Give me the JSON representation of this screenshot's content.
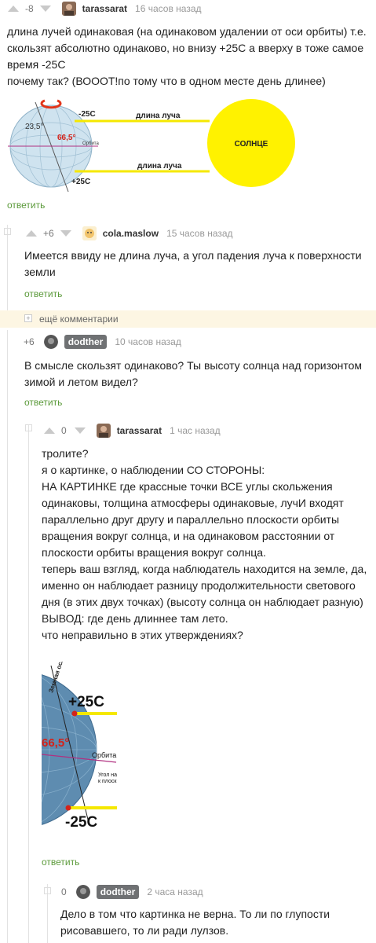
{
  "comments": [
    {
      "rating": "-8",
      "user": "tarassarat",
      "time": "16 часов назад",
      "text": [
        "длина лучей одинаковая (на одинаковом удалении от оси орбиты) т.е.",
        "скользят абсолютно одинаково, но внизу +25С а вверху в тоже самое",
        "время -25С",
        "почему так? (ВОООТ!по тому что в одном месте день длинее)"
      ],
      "reply": "ответить",
      "diagram1": {
        "top_temp": "-25С",
        "bottom_temp": "+25С",
        "ray_label_top": "длина луча",
        "ray_label_bottom": "длина луча",
        "sun_label": "СОЛНЦЕ",
        "angle_small": "23,5°",
        "angle_big": "66,5°",
        "orbit_label": "Орбита"
      }
    },
    {
      "rating": "+6",
      "user": "cola.maslow",
      "time": "15 часов назад",
      "text": [
        "Имеется ввиду не длина луча, а угол падения луча к поверхности",
        "земли"
      ],
      "reply": "ответить"
    },
    {
      "more": "ещё комментарии"
    },
    {
      "rating": "+6",
      "user": "dodther",
      "time": "10 часов назад",
      "text": [
        "В смысле скользят одинаково? Ты высоту солнца над горизонтом",
        "зимой и летом видел?"
      ],
      "reply": "ответить"
    },
    {
      "rating": "0",
      "user": "tarassarat",
      "time": "1 час назад",
      "text": [
        "тролите?",
        "я о картинке, о наблюдении СО СТОРОНЫ:",
        "НА КАРТИНКЕ где крассные точки ВСЕ углы скольжения",
        "одинаковы, толщина атмосферы одинаковые, лучИ входят",
        "параллельно друг другу и параллельно плоскости орбиты",
        "вращения вокруг солнца, и на одинаковом расстоянии от",
        "плоскости орбиты вращения вокруг солнца.",
        "теперь ваш взгляд, когда наблюдатель находится на земле, да,",
        "именно он наблюдает разницу продолжительности светового",
        "дня (в этих двух точках) (высоту солнца он наблюдает разную)",
        "ВЫВОД: где день длиннее там лето.",
        "что неправильно в этих утверждениях?"
      ],
      "reply": "ответить",
      "diagram2": {
        "axis_label": "Земная ось",
        "top_temp": "+25С",
        "bottom_temp": "-25С",
        "angle": "66,5°",
        "orbit_label": "Орбита",
        "angle_note_1": "Угол на",
        "angle_note_2": "к плоск"
      }
    },
    {
      "rating": "0",
      "user": "dodther",
      "time": "2 часа назад",
      "text": [
        "Дело в том что картинка не верна. То ли по глупости",
        "рисовавшего, то ли ради лулзов."
      ]
    }
  ],
  "colors": {
    "reply": "#5b9a3a",
    "sun": "#fff200",
    "more_bg": "#fdf6e3",
    "badge": "#6f7173"
  }
}
